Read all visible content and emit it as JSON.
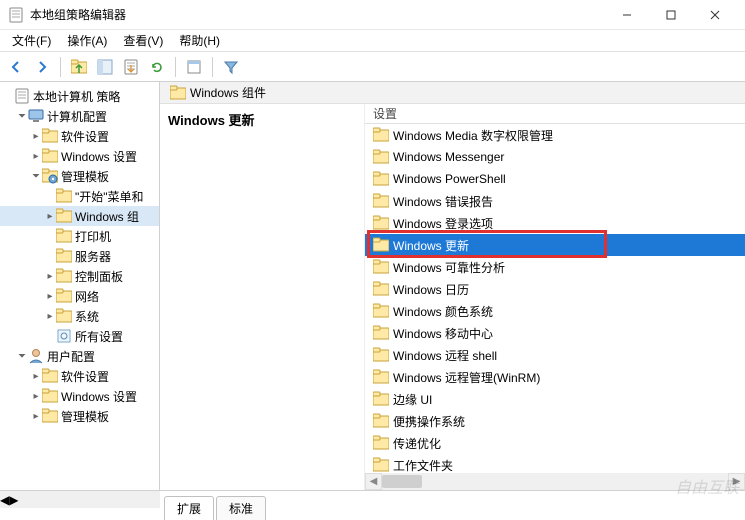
{
  "window": {
    "title": "本地组策略编辑器"
  },
  "menu": {
    "file": "文件(F)",
    "action": "操作(A)",
    "view": "查看(V)",
    "help": "帮助(H)"
  },
  "tree": {
    "root": "本地计算机 策略",
    "n1": "计算机配置",
    "n1a": "软件设置",
    "n1b": "Windows 设置",
    "n1c": "管理模板",
    "n1c1": "\"开始\"菜单和",
    "n1c2": "Windows 组",
    "n1c3": "打印机",
    "n1c4": "服务器",
    "n1c5": "控制面板",
    "n1c6": "网络",
    "n1c7": "系统",
    "n1c8": "所有设置",
    "n2": "用户配置",
    "n2a": "软件设置",
    "n2b": "Windows 设置",
    "n2c": "管理模板"
  },
  "path": {
    "label": "Windows 组件"
  },
  "desc": {
    "heading": "Windows 更新"
  },
  "list": {
    "header": "设置",
    "items": [
      "Windows Media 数字权限管理",
      "Windows Messenger",
      "Windows PowerShell",
      "Windows 错误报告",
      "Windows 登录选项",
      "Windows 更新",
      "Windows 可靠性分析",
      "Windows 日历",
      "Windows 颜色系统",
      "Windows 移动中心",
      "Windows 远程 shell",
      "Windows 远程管理(WinRM)",
      "边缘 UI",
      "便携操作系统",
      "传递优化",
      "工作文件夹"
    ]
  },
  "tabs": {
    "extended": "扩展",
    "standard": "标准"
  },
  "watermark": "自由互联"
}
